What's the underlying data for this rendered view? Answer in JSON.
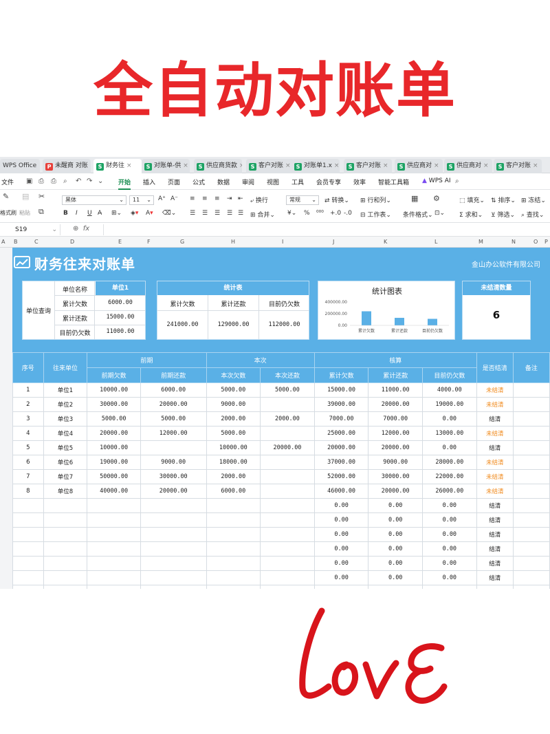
{
  "banner": {
    "title": "全自动对账单"
  },
  "tabs": [
    {
      "label": "WPS Office",
      "type": "home"
    },
    {
      "label": "未醒商 对账",
      "type": "pdf"
    },
    {
      "label": "财务往",
      "type": "sheet",
      "active": true
    },
    {
      "label": "对账单-供",
      "type": "sheet"
    },
    {
      "label": "供应商货款",
      "type": "sheet"
    },
    {
      "label": "客户对账",
      "type": "sheet"
    },
    {
      "label": "对账单1.x",
      "type": "sheet"
    },
    {
      "label": "客户对账",
      "type": "sheet"
    },
    {
      "label": "供应商对",
      "type": "sheet"
    },
    {
      "label": "供应商对",
      "type": "sheet"
    },
    {
      "label": "客户对账",
      "type": "sheet"
    }
  ],
  "menu": {
    "file": "文件",
    "items": [
      "开始",
      "插入",
      "页面",
      "公式",
      "数据",
      "审阅",
      "视图",
      "工具",
      "会员专享",
      "效率",
      "智能工具箱"
    ],
    "active": "开始",
    "wps_ai": "WPS AI"
  },
  "ribbon": {
    "format_painter": "格式刷",
    "paste": "粘贴",
    "font_name": "黑体",
    "font_size": "11",
    "number_format": "常规",
    "wrap": "换行",
    "merge": "合并",
    "convert": "转换",
    "row_col": "行和列",
    "worksheet": "工作表",
    "cond_format": "条件格式",
    "fill": "填充",
    "sort": "排序",
    "freeze": "冻结",
    "sum": "求和",
    "filter": "筛选",
    "find": "查找"
  },
  "formula_bar": {
    "cell_ref": "S19",
    "fx": "fx"
  },
  "columns": [
    "A",
    "B",
    "C",
    "D",
    "E",
    "F",
    "G",
    "H",
    "I",
    "J",
    "K",
    "L",
    "M",
    "N",
    "O",
    "P"
  ],
  "sheet": {
    "title": "财务往来对账单",
    "company": "金山办公软件有限公司",
    "query": {
      "section_label": "单位查询",
      "name_label": "单位名称",
      "name_value": "单位1",
      "rows": [
        {
          "label": "累计欠数",
          "value": "6000.00"
        },
        {
          "label": "累计还款",
          "value": "15000.00"
        },
        {
          "label": "目前仍欠数",
          "value": "11000.00"
        }
      ]
    },
    "stats": {
      "title": "统计表",
      "headers": [
        "累计欠数",
        "累计还款",
        "目前仍欠数"
      ],
      "values": [
        "241000.00",
        "129000.00",
        "112000.00"
      ]
    },
    "unsettled": {
      "title": "未结清数量",
      "value": "6"
    },
    "chart": {
      "title": "统计图表",
      "y_ticks": [
        "400000.00",
        "200000.00",
        "0.00"
      ]
    },
    "table": {
      "headers": {
        "seq": "序号",
        "unit": "往来单位",
        "prior": "前期",
        "current": "本次",
        "calc": "核算",
        "settled": "是否结清",
        "note": "备注",
        "prior_sub": [
          "前期欠数",
          "前期还款"
        ],
        "current_sub": [
          "本次欠数",
          "本次还款"
        ],
        "calc_sub": [
          "累计欠数",
          "累计还款",
          "目前仍欠数"
        ]
      },
      "rows": [
        [
          "1",
          "单位1",
          "10000.00",
          "6000.00",
          "5000.00",
          "5000.00",
          "15000.00",
          "11000.00",
          "4000.00",
          "未结清"
        ],
        [
          "2",
          "单位2",
          "30000.00",
          "20000.00",
          "9000.00",
          "",
          "39000.00",
          "20000.00",
          "19000.00",
          "未结清"
        ],
        [
          "3",
          "单位3",
          "5000.00",
          "5000.00",
          "2000.00",
          "2000.00",
          "7000.00",
          "7000.00",
          "0.00",
          "结清"
        ],
        [
          "4",
          "单位4",
          "20000.00",
          "12000.00",
          "5000.00",
          "",
          "25000.00",
          "12000.00",
          "13000.00",
          "未结清"
        ],
        [
          "5",
          "单位5",
          "10000.00",
          "",
          "10000.00",
          "20000.00",
          "20000.00",
          "20000.00",
          "0.00",
          "结清"
        ],
        [
          "6",
          "单位6",
          "19000.00",
          "9000.00",
          "18000.00",
          "",
          "37000.00",
          "9000.00",
          "28000.00",
          "未结清"
        ],
        [
          "7",
          "单位7",
          "50000.00",
          "30000.00",
          "2000.00",
          "",
          "52000.00",
          "30000.00",
          "22000.00",
          "未结清"
        ],
        [
          "8",
          "单位8",
          "40000.00",
          "20000.00",
          "6000.00",
          "",
          "46000.00",
          "20000.00",
          "26000.00",
          "未结清"
        ],
        [
          "",
          "",
          "",
          "",
          "",
          "",
          "0.00",
          "0.00",
          "0.00",
          "结清"
        ],
        [
          "",
          "",
          "",
          "",
          "",
          "",
          "0.00",
          "0.00",
          "0.00",
          "结清"
        ],
        [
          "",
          "",
          "",
          "",
          "",
          "",
          "0.00",
          "0.00",
          "0.00",
          "结清"
        ],
        [
          "",
          "",
          "",
          "",
          "",
          "",
          "0.00",
          "0.00",
          "0.00",
          "结清"
        ],
        [
          "",
          "",
          "",
          "",
          "",
          "",
          "0.00",
          "0.00",
          "0.00",
          "结清"
        ],
        [
          "",
          "",
          "",
          "",
          "",
          "",
          "0.00",
          "0.00",
          "0.00",
          "结清"
        ],
        [
          "",
          "",
          "",
          "",
          "",
          "",
          "0.00",
          "0.00",
          "0.00",
          "结清"
        ]
      ]
    }
  },
  "chart_data": {
    "type": "bar",
    "title": "统计图表",
    "categories": [
      "累计欠数",
      "累计还款",
      "目前仍欠数"
    ],
    "values": [
      241000,
      129000,
      112000
    ],
    "ylim": [
      0,
      400000
    ],
    "color": "#5ab0e6"
  },
  "colors": {
    "banner_red": "#e8272a",
    "sheet_blue": "#5ab0e6",
    "unsettled_orange": "#f08a1c",
    "love_red": "#d8141b"
  },
  "decoration": {
    "handwriting": "love"
  }
}
